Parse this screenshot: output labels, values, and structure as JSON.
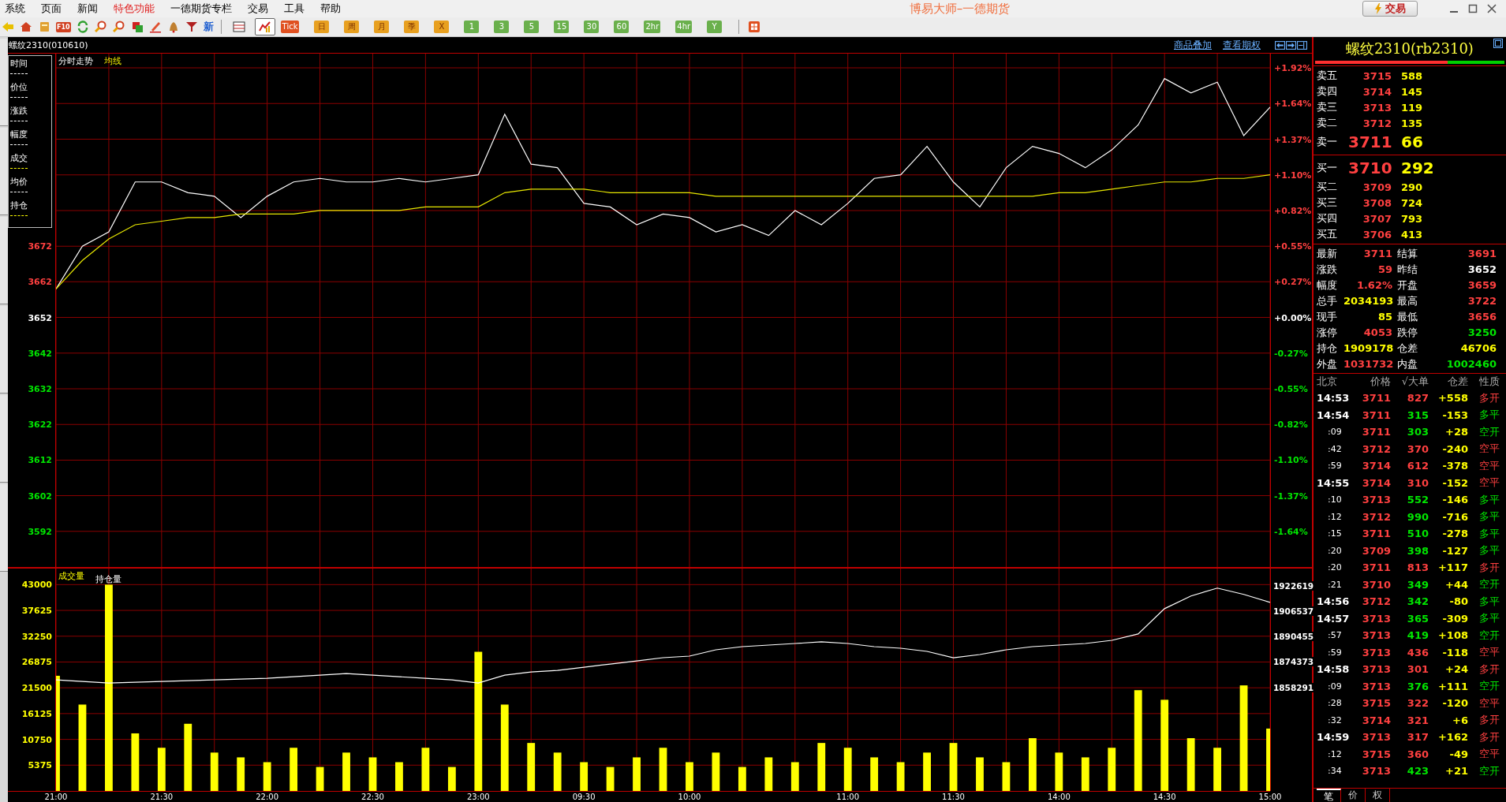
{
  "menu": [
    {
      "label": "系统",
      "kind": "normal"
    },
    {
      "label": "页面",
      "kind": "normal"
    },
    {
      "label": "新闻",
      "kind": "normal"
    },
    {
      "label": "特色功能",
      "kind": "highlight"
    },
    {
      "label": "一德期货专栏",
      "kind": "normal"
    },
    {
      "label": "交易",
      "kind": "normal"
    },
    {
      "label": "工具",
      "kind": "normal"
    },
    {
      "label": "帮助",
      "kind": "normal"
    }
  ],
  "window_title": "博易大师–一德期货",
  "trade_button": "交易",
  "toolbar": {
    "f10_label": "F10",
    "new_label": "新",
    "view_buttons": [
      {
        "selected": false
      },
      {
        "selected": true
      }
    ],
    "period_buttons": [
      {
        "label": "Tick",
        "kind": "red"
      },
      {
        "label": "日",
        "kind": "orange"
      },
      {
        "label": "周",
        "kind": "orange"
      },
      {
        "label": "月",
        "kind": "orange"
      },
      {
        "label": "季",
        "kind": "orange"
      },
      {
        "label": "X",
        "kind": "orange"
      },
      {
        "label": "1",
        "kind": "green"
      },
      {
        "label": "3",
        "kind": "green"
      },
      {
        "label": "5",
        "kind": "green"
      },
      {
        "label": "15",
        "kind": "green"
      },
      {
        "label": "30",
        "kind": "green"
      },
      {
        "label": "60",
        "kind": "green"
      },
      {
        "label": "2hr",
        "kind": "green"
      },
      {
        "label": "4hr",
        "kind": "green"
      },
      {
        "label": "Y",
        "kind": "green"
      }
    ]
  },
  "chart_header": {
    "title": "螺纹2310(010610)",
    "links": [
      "商品叠加",
      "查看期权"
    ]
  },
  "legend": [
    {
      "label": "时间",
      "color": "#ffffff"
    },
    {
      "label": "价位",
      "color": "#ffffff"
    },
    {
      "label": "涨跌",
      "color": "#ffffff"
    },
    {
      "label": "幅度",
      "color": "#ffffff"
    },
    {
      "label": "成交",
      "color": "#ffff00"
    },
    {
      "label": "均价",
      "color": "#ffffff"
    },
    {
      "label": "持仓",
      "color": "#ffff00"
    }
  ],
  "price_panel": {
    "percent_labels": [
      {
        "label": "+1.92%",
        "kind": "up"
      },
      {
        "label": "+1.64%",
        "kind": "up"
      },
      {
        "label": "+1.37%",
        "kind": "up"
      },
      {
        "label": "+1.10%",
        "kind": "up"
      },
      {
        "label": "+0.82%",
        "kind": "up"
      },
      {
        "label": "+0.55%",
        "kind": "up"
      },
      {
        "label": "+0.27%",
        "kind": "up"
      },
      {
        "label": "+0.00%",
        "kind": "flat"
      },
      {
        "label": "-0.27%",
        "kind": "down"
      },
      {
        "label": "-0.55%",
        "kind": "down"
      },
      {
        "label": "-0.82%",
        "kind": "down"
      },
      {
        "label": "-1.10%",
        "kind": "down"
      },
      {
        "label": "-1.37%",
        "kind": "down"
      },
      {
        "label": "-1.64%",
        "kind": "down"
      }
    ],
    "chart_data": {
      "type": "line",
      "series": [
        {
          "name": "分时走势",
          "color": "#ffffff",
          "values": [
            3660,
            3672,
            3676,
            3690,
            3690,
            3687,
            3686,
            3680,
            3686,
            3690,
            3691,
            3690,
            3690,
            3691,
            3690,
            3691,
            3692,
            3709,
            3695,
            3694,
            3684,
            3683,
            3678,
            3681,
            3680,
            3676,
            3678,
            3675,
            3682,
            3678,
            3684,
            3691,
            3692,
            3700,
            3690,
            3683,
            3694,
            3700,
            3698,
            3694,
            3699,
            3706,
            3719,
            3715,
            3718,
            3703,
            3711
          ]
        },
        {
          "name": "均线",
          "color": "#e8e800",
          "values": [
            3660,
            3668,
            3674,
            3678,
            3679,
            3680,
            3680,
            3681,
            3681,
            3681,
            3682,
            3682,
            3682,
            3682,
            3683,
            3683,
            3683,
            3687,
            3688,
            3688,
            3688,
            3687,
            3687,
            3687,
            3687,
            3686,
            3686,
            3686,
            3686,
            3686,
            3686,
            3686,
            3686,
            3686,
            3686,
            3686,
            3686,
            3686,
            3687,
            3687,
            3688,
            3689,
            3690,
            3690,
            3691,
            3691,
            3692
          ]
        }
      ],
      "ylim": [
        3582,
        3726
      ],
      "grid": true,
      "yticks": [
        {
          "value": 3592,
          "label": "3592"
        },
        {
          "value": 3602,
          "label": "3602"
        },
        {
          "value": 3612,
          "label": "3612"
        },
        {
          "value": 3622,
          "label": "3622"
        },
        {
          "value": 3632,
          "label": "3632"
        },
        {
          "value": 3642,
          "label": "3642"
        },
        {
          "value": 3652,
          "label": "3652"
        },
        {
          "value": 3662,
          "label": "3662"
        },
        {
          "value": 3672,
          "label": "3672"
        }
      ]
    }
  },
  "volume_panel": {
    "chart_data": {
      "type": "bar",
      "categories": [
        "21:00",
        null,
        null,
        null,
        "21:30",
        null,
        null,
        null,
        "22:00",
        null,
        null,
        null,
        "22:30",
        null,
        null,
        null,
        "23:00",
        null,
        null,
        null,
        "09:30",
        null,
        null,
        null,
        "10:00",
        null,
        null,
        null,
        null,
        null,
        "11:00",
        null,
        null,
        null,
        "11:30",
        null,
        null,
        null,
        "14:00",
        null,
        null,
        null,
        "14:30",
        null,
        null,
        null,
        "15:00"
      ],
      "series": [
        {
          "name": "成交量",
          "color": "#ffff00",
          "values": [
            24000,
            18000,
            43000,
            12000,
            9000,
            14000,
            8000,
            7000,
            6000,
            9000,
            5000,
            8000,
            7000,
            6000,
            9000,
            5000,
            29000,
            18000,
            10000,
            8000,
            6000,
            5000,
            7000,
            9000,
            6000,
            8000,
            5000,
            7000,
            6000,
            10000,
            9000,
            7000,
            6000,
            8000,
            10000,
            7000,
            6000,
            11000,
            8000,
            7000,
            9000,
            21000,
            19000,
            11000,
            9000,
            22000,
            13000
          ]
        }
      ],
      "ylim": [
        0,
        46340
      ],
      "grid": true,
      "yticks": [
        5375,
        10750,
        16125,
        21500,
        26875,
        32250,
        37625,
        43000
      ]
    },
    "open_interest": {
      "chart_data": {
        "type": "line",
        "series": [
          {
            "name": "持仓量",
            "color": "#ffffff",
            "values": [
              1863000,
              1862000,
              1861000,
              1861500,
              1862000,
              1862500,
              1863000,
              1863500,
              1864000,
              1865000,
              1866000,
              1867000,
              1866000,
              1865000,
              1864000,
              1863000,
              1861000,
              1866000,
              1868000,
              1869000,
              1871000,
              1873000,
              1875000,
              1877000,
              1878000,
              1882000,
              1884000,
              1885000,
              1886000,
              1887000,
              1886000,
              1884000,
              1883000,
              1881000,
              1877000,
              1879000,
              1882000,
              1884000,
              1885000,
              1886000,
              1888000,
              1892000,
              1908000,
              1916000,
              1921000,
              1917000,
              1912000
            ]
          }
        ],
        "ylim": [
          1792773,
          1933340
        ],
        "yticks": [
          1858291,
          1874373,
          1890455,
          1906537,
          1922619
        ]
      }
    }
  },
  "quote": {
    "title": "螺纹2310(rb2310)",
    "ratio": {
      "level": 0.7
    },
    "asks": [
      {
        "label": "卖五",
        "price": "3715",
        "volume": "588",
        "kind": "normal"
      },
      {
        "label": "卖四",
        "price": "3714",
        "volume": "145",
        "kind": "normal"
      },
      {
        "label": "卖三",
        "price": "3713",
        "volume": "119",
        "kind": "normal"
      },
      {
        "label": "卖二",
        "price": "3712",
        "volume": "135",
        "kind": "normal"
      },
      {
        "label": "卖一",
        "price": "3711",
        "volume": "66",
        "kind": "best"
      }
    ],
    "bids": [
      {
        "label": "买一",
        "price": "3710",
        "volume": "292",
        "kind": "best"
      },
      {
        "label": "买二",
        "price": "3709",
        "volume": "290",
        "kind": "normal"
      },
      {
        "label": "买三",
        "price": "3708",
        "volume": "724",
        "kind": "normal"
      },
      {
        "label": "买四",
        "price": "3707",
        "volume": "793",
        "kind": "normal"
      },
      {
        "label": "买五",
        "price": "3706",
        "volume": "413",
        "kind": "normal"
      }
    ],
    "stats": [
      {
        "label": "最新",
        "value": "3711",
        "color": "#ff4040"
      },
      {
        "label": "结算",
        "value": "3691",
        "color": "#ff4040"
      },
      {
        "label": "涨跌",
        "value": "59",
        "color": "#ff4040"
      },
      {
        "label": "昨结",
        "value": "3652",
        "color": "#ffffff"
      },
      {
        "label": "幅度",
        "value": "1.62%",
        "color": "#ff4040"
      },
      {
        "label": "开盘",
        "value": "3659",
        "color": "#ff4040"
      },
      {
        "label": "总手",
        "value": "2034193",
        "color": "#ffff00"
      },
      {
        "label": "最高",
        "value": "3722",
        "color": "#ff4040"
      },
      {
        "label": "现手",
        "value": "85",
        "color": "#ffff00"
      },
      {
        "label": "最低",
        "value": "3656",
        "color": "#ff4040"
      },
      {
        "label": "涨停",
        "value": "4053",
        "color": "#ff4040"
      },
      {
        "label": "跌停",
        "value": "3250",
        "color": "#00e600"
      },
      {
        "label": "持仓",
        "value": "1909178",
        "color": "#ffff00"
      },
      {
        "label": "仓差",
        "value": "46706",
        "color": "#ffff00"
      },
      {
        "label": "外盘",
        "value": "1031732",
        "color": "#ff4040"
      },
      {
        "label": "内盘",
        "value": "1002460",
        "color": "#00e600"
      }
    ],
    "trade_columns": [
      "北京",
      "价格",
      "√大单",
      "仓差",
      "性质"
    ],
    "trades": [
      {
        "time": "14:53",
        "kind": "minute",
        "price": "3711",
        "volume": "827",
        "oi_change": "+558",
        "nature": "多开",
        "color": "#ff4040"
      },
      {
        "time": "14:54",
        "kind": "minute",
        "price": "3711",
        "volume": "315",
        "oi_change": "-153",
        "nature": "多平",
        "color": "#00e600"
      },
      {
        "time": ":09",
        "kind": "second",
        "price": "3711",
        "volume": "303",
        "oi_change": "+28",
        "nature": "空开",
        "color": "#00e600"
      },
      {
        "time": ":42",
        "kind": "second",
        "price": "3712",
        "volume": "370",
        "oi_change": "-240",
        "nature": "空平",
        "color": "#ff4040"
      },
      {
        "time": ":59",
        "kind": "second",
        "price": "3714",
        "volume": "612",
        "oi_change": "-378",
        "nature": "空平",
        "color": "#ff4040"
      },
      {
        "time": "14:55",
        "kind": "minute",
        "price": "3714",
        "volume": "310",
        "oi_change": "-152",
        "nature": "空平",
        "color": "#ff4040"
      },
      {
        "time": ":10",
        "kind": "second",
        "price": "3713",
        "volume": "552",
        "oi_change": "-146",
        "nature": "多平",
        "color": "#00e600"
      },
      {
        "time": ":12",
        "kind": "second",
        "price": "3712",
        "volume": "990",
        "oi_change": "-716",
        "nature": "多平",
        "color": "#00e600"
      },
      {
        "time": ":15",
        "kind": "second",
        "price": "3711",
        "volume": "510",
        "oi_change": "-278",
        "nature": "多平",
        "color": "#00e600"
      },
      {
        "time": ":20",
        "kind": "second",
        "price": "3709",
        "volume": "398",
        "oi_change": "-127",
        "nature": "多平",
        "color": "#00e600"
      },
      {
        "time": ":20",
        "kind": "second",
        "price": "3711",
        "volume": "813",
        "oi_change": "+117",
        "nature": "多开",
        "color": "#ff4040"
      },
      {
        "time": ":21",
        "kind": "second",
        "price": "3710",
        "volume": "349",
        "oi_change": "+44",
        "nature": "空开",
        "color": "#00e600"
      },
      {
        "time": "14:56",
        "kind": "minute",
        "price": "3712",
        "volume": "342",
        "oi_change": "-80",
        "nature": "多平",
        "color": "#00e600"
      },
      {
        "time": "14:57",
        "kind": "minute",
        "price": "3713",
        "volume": "365",
        "oi_change": "-309",
        "nature": "多平",
        "color": "#00e600"
      },
      {
        "time": ":57",
        "kind": "second",
        "price": "3713",
        "volume": "419",
        "oi_change": "+108",
        "nature": "空开",
        "color": "#00e600"
      },
      {
        "time": ":59",
        "kind": "second",
        "price": "3713",
        "volume": "436",
        "oi_change": "-118",
        "nature": "空平",
        "color": "#ff4040"
      },
      {
        "time": "14:58",
        "kind": "minute",
        "price": "3713",
        "volume": "301",
        "oi_change": "+24",
        "nature": "多开",
        "color": "#ff4040"
      },
      {
        "time": ":09",
        "kind": "second",
        "price": "3713",
        "volume": "376",
        "oi_change": "+111",
        "nature": "空开",
        "color": "#00e600"
      },
      {
        "time": ":28",
        "kind": "second",
        "price": "3715",
        "volume": "322",
        "oi_change": "-120",
        "nature": "空平",
        "color": "#ff4040"
      },
      {
        "time": ":32",
        "kind": "second",
        "price": "3714",
        "volume": "321",
        "oi_change": "+6",
        "nature": "多开",
        "color": "#ff4040"
      },
      {
        "time": "14:59",
        "kind": "minute",
        "price": "3713",
        "volume": "317",
        "oi_change": "+162",
        "nature": "多开",
        "color": "#ff4040"
      },
      {
        "time": ":12",
        "kind": "second",
        "price": "3715",
        "volume": "360",
        "oi_change": "-49",
        "nature": "空平",
        "color": "#ff4040"
      },
      {
        "time": ":34",
        "kind": "second",
        "price": "3713",
        "volume": "423",
        "oi_change": "+21",
        "nature": "空开",
        "color": "#00e600"
      }
    ],
    "tabs": [
      {
        "label": "笔",
        "selected": true
      },
      {
        "label": "价",
        "selected": false
      },
      {
        "label": "权",
        "selected": false
      }
    ]
  }
}
